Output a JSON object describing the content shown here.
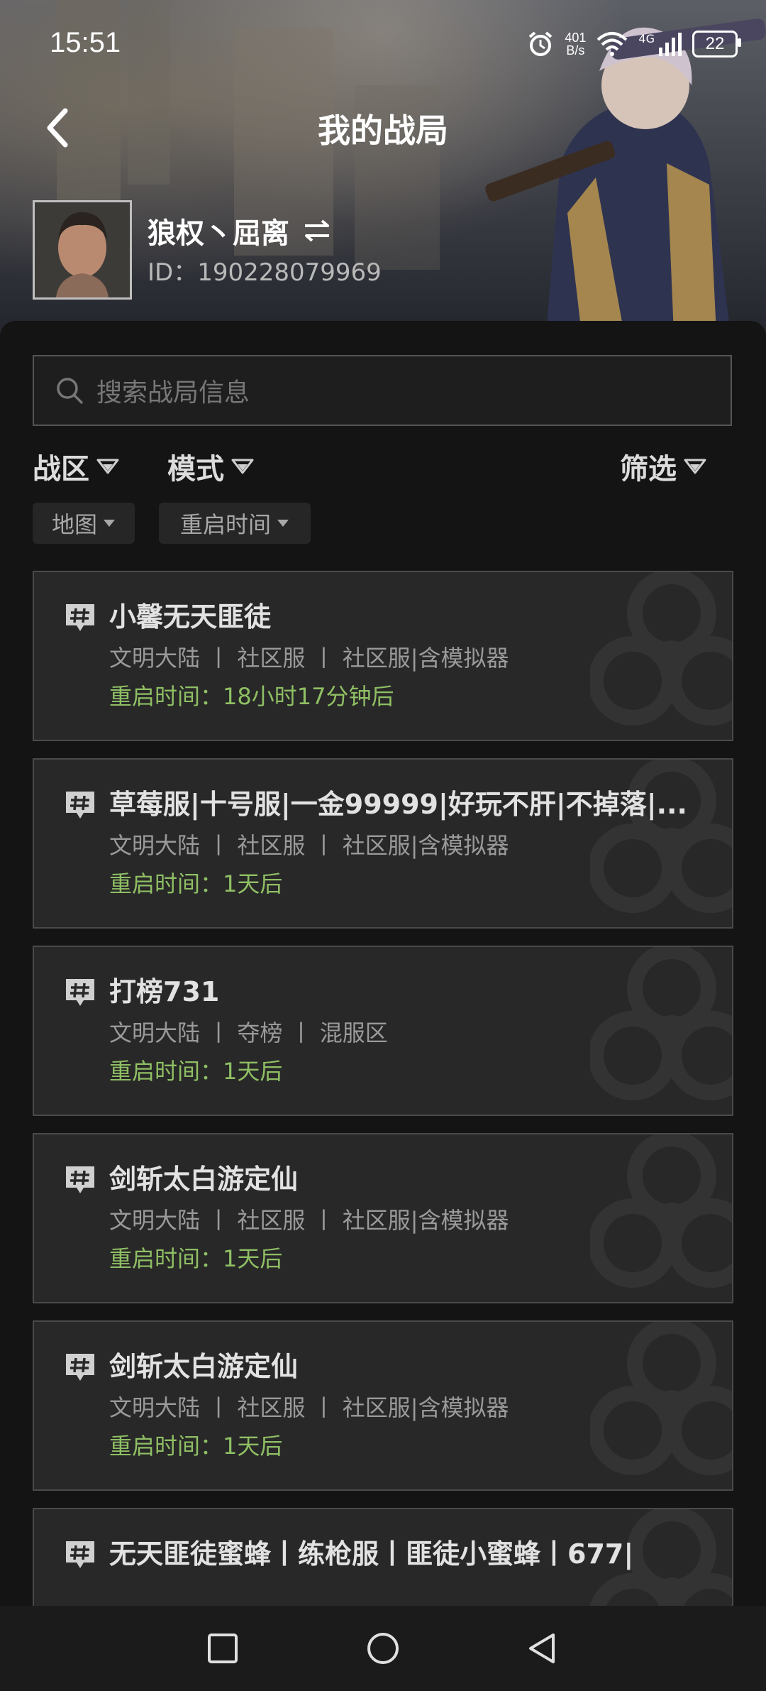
{
  "status_bar": {
    "time": "15:51",
    "net_speed_value": "401",
    "net_speed_unit": "B/s",
    "network_type": "4G",
    "battery": "22"
  },
  "header": {
    "title": "我的战局"
  },
  "profile": {
    "nickname": "狼权丶屈离",
    "id": "ID：190228079969"
  },
  "search": {
    "placeholder": "搜索战局信息"
  },
  "filters": {
    "region": "战区",
    "mode": "模式",
    "filter": "筛选",
    "chip_map": "地图",
    "chip_reset": "重启时间"
  },
  "cards": [
    {
      "title": "小馨无天匪徒",
      "tags": "文明大陆 丨 社区服 丨 社区服|含模拟器",
      "reset": "重启时间：18小时17分钟后"
    },
    {
      "title": "草莓服|十号服|一金99999|好玩不肝|不掉落|...",
      "tags": "文明大陆 丨 社区服 丨 社区服|含模拟器",
      "reset": "重启时间：1天后"
    },
    {
      "title": "打榜731",
      "tags": "文明大陆 丨 夺榜 丨 混服区",
      "reset": "重启时间：1天后"
    },
    {
      "title": "剑斩太白游定仙",
      "tags": "文明大陆 丨 社区服 丨 社区服|含模拟器",
      "reset": "重启时间：1天后"
    },
    {
      "title": "剑斩太白游定仙",
      "tags": "文明大陆 丨 社区服 丨 社区服|含模拟器",
      "reset": "重启时间：1天后"
    },
    {
      "title": "无天匪徒蜜蜂丨练枪服丨匪徒小蜜蜂丨677|",
      "tags": "",
      "reset": ""
    }
  ],
  "icons": {
    "back": "chevron-left-icon",
    "swap": "swap-icon",
    "search": "search-icon",
    "dropdown": "triangle-down-icon",
    "hash": "hash-message-icon",
    "watermark": "biohazard-icon",
    "nav_recent": "square-icon",
    "nav_home": "circle-icon",
    "nav_back": "triangle-left-icon"
  },
  "colors": {
    "accent_green": "#8fbf64",
    "card_bg": "#282828",
    "page_bg": "#141414"
  }
}
